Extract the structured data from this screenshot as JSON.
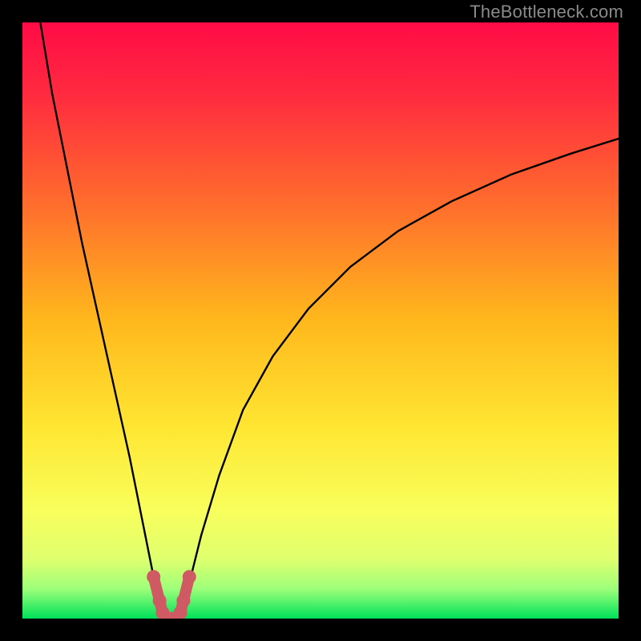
{
  "watermark": "TheBottleneck.com",
  "chart_data": {
    "type": "line",
    "title": "",
    "xlabel": "",
    "ylabel": "",
    "xlim": [
      0,
      100
    ],
    "ylim": [
      0,
      100
    ],
    "grid": false,
    "legend": false,
    "background_gradient": [
      "#ff0b46",
      "#ffd400",
      "#f6ff5c",
      "#00e15a"
    ],
    "series": [
      {
        "name": "left-branch",
        "color": "#000000",
        "x": [
          3,
          5,
          8,
          10,
          12,
          14,
          16,
          18,
          20,
          22,
          23.5
        ],
        "y": [
          100,
          88,
          73,
          63,
          54,
          45,
          36,
          27,
          17,
          7,
          0
        ]
      },
      {
        "name": "right-branch",
        "color": "#000000",
        "x": [
          26.5,
          28,
          30,
          33,
          37,
          42,
          48,
          55,
          63,
          72,
          82,
          92,
          100
        ],
        "y": [
          0,
          6,
          14,
          24,
          35,
          44,
          52,
          59,
          65,
          70,
          74.5,
          78,
          80.5
        ]
      },
      {
        "name": "valley-marker",
        "color": "#cf5a64",
        "x": [
          22,
          23,
          23.5,
          24,
          25,
          26,
          26.5,
          27,
          28
        ],
        "y": [
          7,
          3,
          1,
          0,
          0,
          0,
          1,
          3,
          7
        ]
      }
    ]
  }
}
